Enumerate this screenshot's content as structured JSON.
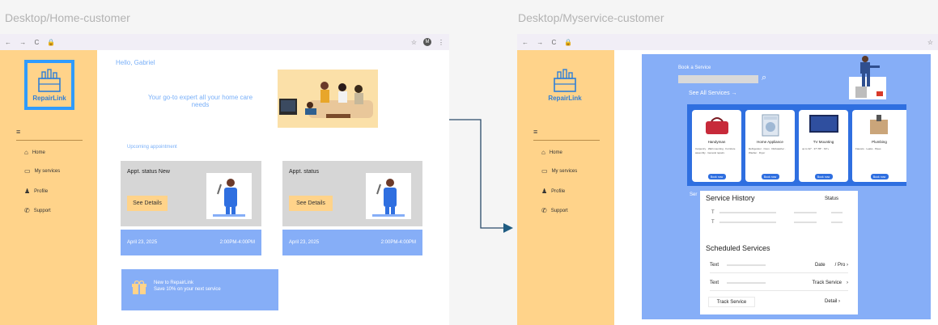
{
  "frames": {
    "left_title": "Desktop/Home-customer",
    "right_title": "Desktop/Myservice-customer"
  },
  "browser": {
    "nav_glyphs": "← → C",
    "lock_glyph": "🔒",
    "star_glyph": "☆",
    "avatar_letter": "M",
    "more_glyph": "⋮"
  },
  "sidebar": {
    "logo_text": "RepairLink",
    "menu_glyph": "≡",
    "items": [
      {
        "icon": "home-icon",
        "glyph": "⌂",
        "label": "Home"
      },
      {
        "icon": "folder-icon",
        "glyph": "▭",
        "label": "My services"
      },
      {
        "icon": "user-icon",
        "glyph": "♟",
        "label": "Profile"
      },
      {
        "icon": "megaphone-icon",
        "glyph": "✆",
        "label": "Support"
      }
    ]
  },
  "home": {
    "greeting": "Hello, Gabriel",
    "tagline": "Your go-to expert all your home care needs",
    "upcoming_label": "Upcoming appointment",
    "appointments": [
      {
        "title": "Appt. status New",
        "details": "See Details",
        "date": "April 23, 2025",
        "time": "2:00PM-4:00PM"
      },
      {
        "title": "Appt. status",
        "details": "See Details",
        "date": "April 23, 2025",
        "time": "2:00PM-4:00PM"
      }
    ],
    "promo_title": "New to RepairLink",
    "promo_body": "Save 10% on your next service"
  },
  "myservice": {
    "book_label": "Book a Service",
    "see_all": "See All Services →",
    "search_glyph": "⌕",
    "services": [
      {
        "name": "Handyman",
        "lines": "Carpentry · Wall mounting · Furniture assembly · General repairs",
        "cta": "Book now"
      },
      {
        "name": "Home Appliance",
        "lines": "Refrigerator · Oven · Dishwasher · Washer · Dryer",
        "cta": "Book now"
      },
      {
        "name": "TV Mounting",
        "lines": "up to 32\" · 37\"-55\" · 60\"+",
        "cta": "Book now"
      },
      {
        "name": "Plumbing",
        "lines": "Faucets · Leaks · Pipes",
        "cta": "Book now"
      }
    ],
    "history_title": "Service History",
    "status_label": "Status",
    "history_rows": [
      "T",
      "T"
    ],
    "scheduled_title": "Scheduled Services",
    "scheduled_rows": [
      {
        "col1": "Text",
        "col2": "Date",
        "col3": "/ Pro ›"
      },
      {
        "col1": "Text",
        "col2": "Track Service",
        "col3": "›"
      }
    ],
    "track_label": "Track Service",
    "detail_label": "Detail ›",
    "partial_label": "Ser"
  },
  "colors": {
    "sidebar": "#ffd38a",
    "accent_blue": "#86aef7",
    "button_blue": "#2f6fe0",
    "card_gray": "#d6d6d6"
  }
}
